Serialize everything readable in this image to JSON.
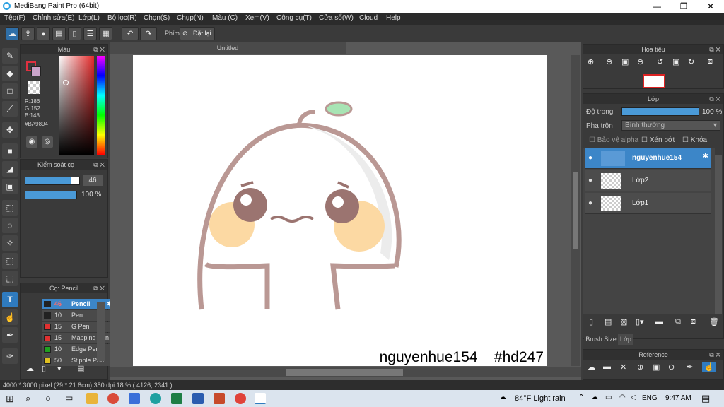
{
  "window": {
    "title": "MediBang Paint Pro (64bit)",
    "minimize": "—",
    "maximize": "❐",
    "close": "✕"
  },
  "menu": [
    "Tệp(F)",
    "Chỉnh sửa(E)",
    "Lớp(L)",
    "Bộ lọc(R)",
    "Chọn(S)",
    "Chụp(N)",
    "Màu (C)",
    "Xem(V)",
    "Công cụ(T)",
    "Cửa sổ(W)",
    "Cloud",
    "Help"
  ],
  "toolbar": {
    "key_label": "Phím",
    "reset_label": "Đặt lại"
  },
  "document": {
    "tab_title": "Untitled",
    "watermark": "nguyenhue154    #hd247"
  },
  "color_panel": {
    "title": "Màu",
    "r": "R:186",
    "g": "G:152",
    "b": "B:148",
    "hex": "#BA9894",
    "fg_color": "#c0454a",
    "bg_color": "#ba9894"
  },
  "brush_control": {
    "title": "Kiểm soát cọ",
    "size": "46",
    "opacity": "100 %",
    "size_fraction": 0.85,
    "opacity_fraction": 1.0
  },
  "brush_panel": {
    "title": "Cọ: Pencil",
    "items": [
      {
        "size": "46",
        "name": "Pencil",
        "color": "#222222",
        "selected": true
      },
      {
        "size": "10",
        "name": "Pen",
        "color": "#222222",
        "selected": false
      },
      {
        "size": "15",
        "name": "G Pen",
        "color": "#e03030",
        "selected": false
      },
      {
        "size": "15",
        "name": "Mapping Pen",
        "color": "#e03030",
        "selected": false
      },
      {
        "size": "10",
        "name": "Edge Pen",
        "color": "#20a020",
        "selected": false
      },
      {
        "size": "50",
        "name": "Stipple Pen",
        "color": "#e0c020",
        "selected": false
      }
    ]
  },
  "navigator": {
    "title": "Hoa tiêu"
  },
  "layer_panel": {
    "title": "Lớp",
    "opacity_label": "Độ trong",
    "opacity_value": "100 %",
    "opacity_fraction": 1.0,
    "blend_label": "Pha trộn",
    "blend_value": "Bình thường",
    "protect_alpha": "Bảo vệ alpha",
    "clipping": "Xén bớt",
    "lock": "Khóa",
    "layers": [
      {
        "name": "nguyenhue154",
        "selected": true
      },
      {
        "name": "Lớp2",
        "selected": false
      },
      {
        "name": "Lớp1",
        "selected": false
      }
    ],
    "tab_brush_size": "Brush Size",
    "tab_layer": "Lớp"
  },
  "reference_panel": {
    "title": "Reference"
  },
  "status": {
    "text": "4000 * 3000 pixel  (29 * 21.8cm)  350 dpi  18 %  ( 4126, 2341 )"
  },
  "taskbar": {
    "weather": "84°F  Light rain",
    "lang": "ENG",
    "time": "9:47 AM"
  }
}
